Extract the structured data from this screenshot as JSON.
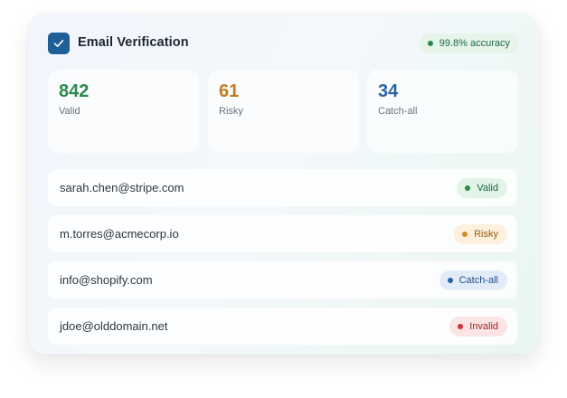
{
  "header": {
    "title": "Email Verification",
    "accuracy": "99.8% accuracy"
  },
  "stats": [
    {
      "value": "842",
      "label": "Valid"
    },
    {
      "value": "61",
      "label": "Risky"
    },
    {
      "value": "34",
      "label": "Catch-all"
    }
  ],
  "emails": [
    {
      "address": "sarah.chen@stripe.com",
      "status": "Valid"
    },
    {
      "address": "m.torres@acmecorp.io",
      "status": "Risky"
    },
    {
      "address": "info@shopify.com",
      "status": "Catch-all"
    },
    {
      "address": "jdoe@olddomain.net",
      "status": "Invalid"
    }
  ],
  "colors": {
    "valid": "#2a8a4a",
    "risky": "#c27c1c",
    "catch_all": "#2a63a6",
    "invalid": "#d03434",
    "accent": "#1f5e96"
  }
}
